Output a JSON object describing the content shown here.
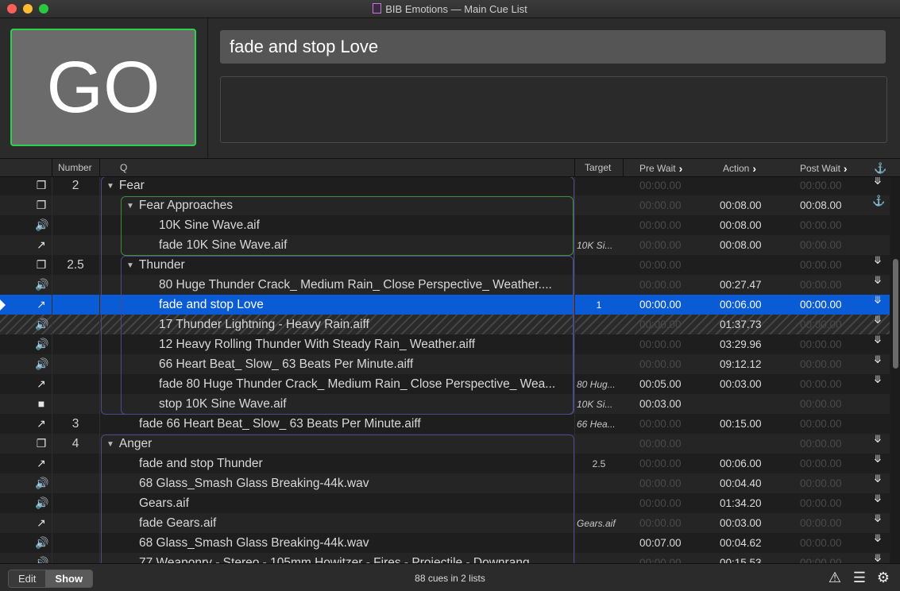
{
  "window": {
    "title": "BIB Emotions — Main Cue List"
  },
  "go_button": {
    "label": "GO"
  },
  "selected_cue": {
    "name": "fade and stop Love",
    "notes": ""
  },
  "columns": {
    "number": "Number",
    "q": "Q",
    "target": "Target",
    "pre_wait": "Pre Wait",
    "action": "Action",
    "post_wait": "Post Wait"
  },
  "cues": [
    {
      "icon": "group",
      "number": "2",
      "name": "Fear",
      "group": true,
      "target": "",
      "pre": "00:00.00",
      "pre_dim": true,
      "action": "",
      "post": "00:00.00",
      "post_dim": true,
      "cont": "auto-follow"
    },
    {
      "icon": "group",
      "number": "",
      "name": "Fear Approaches",
      "group": true,
      "target": "",
      "pre": "00:00.00",
      "pre_dim": true,
      "action": "00:08.00",
      "post": "00:08.00",
      "post_dim": false,
      "cont": "auto-continue"
    },
    {
      "icon": "audio",
      "number": "",
      "name": "10K Sine Wave.aif",
      "target": "",
      "pre": "00:00.00",
      "pre_dim": true,
      "action": "00:08.00",
      "post": "00:00.00",
      "post_dim": true,
      "cont": ""
    },
    {
      "icon": "fade",
      "number": "",
      "name": "fade 10K Sine Wave.aif",
      "target": "10K Si...",
      "pre": "00:00.00",
      "pre_dim": true,
      "action": "00:08.00",
      "post": "00:00.00",
      "post_dim": true,
      "cont": ""
    },
    {
      "icon": "group",
      "number": "2.5",
      "name": "Thunder",
      "group": true,
      "target": "",
      "pre": "00:00.00",
      "pre_dim": true,
      "action": "",
      "post": "00:00.00",
      "post_dim": true,
      "cont": "auto-follow"
    },
    {
      "icon": "audio",
      "number": "",
      "name": "80 Huge Thunder Crack_ Medium Rain_ Close Perspective_ Weather....",
      "target": "",
      "pre": "00:00.00",
      "pre_dim": true,
      "action": "00:27.47",
      "post": "00:00.00",
      "post_dim": true,
      "cont": "auto-follow"
    },
    {
      "icon": "fade",
      "number": "",
      "name": "fade and stop Love",
      "target": "1",
      "target_plain": true,
      "pre": "00:00.00",
      "pre_dim": false,
      "action": "00:06.00",
      "post": "00:00.00",
      "post_dim": false,
      "cont": "auto-follow",
      "selected": true,
      "playhead": true
    },
    {
      "icon": "audio",
      "number": "",
      "name": "17 Thunder Lightning - Heavy Rain.aiff",
      "target": "",
      "pre": "00:00.00",
      "pre_dim": true,
      "action": "01:37.73",
      "post": "00:00.00",
      "post_dim": true,
      "cont": "auto-follow",
      "broken": true
    },
    {
      "icon": "audio",
      "number": "",
      "name": "12 Heavy Rolling Thunder With Steady Rain_ Weather.aiff",
      "target": "",
      "pre": "00:00.00",
      "pre_dim": true,
      "action": "03:29.96",
      "post": "00:00.00",
      "post_dim": true,
      "cont": "auto-follow"
    },
    {
      "icon": "audio",
      "number": "",
      "name": "66 Heart Beat_ Slow_ 63 Beats Per Minute.aiff",
      "target": "",
      "pre": "00:00.00",
      "pre_dim": true,
      "action": "09:12.12",
      "post": "00:00.00",
      "post_dim": true,
      "cont": "auto-follow"
    },
    {
      "icon": "fade",
      "number": "",
      "name": "fade 80 Huge Thunder Crack_ Medium Rain_ Close Perspective_ Wea...",
      "target": "80 Hug...",
      "pre": "00:05.00",
      "pre_dim": false,
      "action": "00:03.00",
      "post": "00:00.00",
      "post_dim": true,
      "cont": "auto-follow"
    },
    {
      "icon": "stop",
      "number": "",
      "name": "stop 10K Sine Wave.aif",
      "target": "10K Si...",
      "pre": "00:03.00",
      "pre_dim": false,
      "action": "",
      "post": "00:00.00",
      "post_dim": true,
      "cont": ""
    },
    {
      "icon": "fade",
      "number": "3",
      "name": "fade 66 Heart Beat_ Slow_ 63 Beats Per Minute.aiff",
      "target": "66 Hea...",
      "pre": "00:00.00",
      "pre_dim": true,
      "action": "00:15.00",
      "post": "00:00.00",
      "post_dim": true,
      "cont": ""
    },
    {
      "icon": "group",
      "number": "4",
      "name": "Anger",
      "group": true,
      "target": "",
      "pre": "00:00.00",
      "pre_dim": true,
      "action": "",
      "post": "00:00.00",
      "post_dim": true,
      "cont": "auto-follow"
    },
    {
      "icon": "fade",
      "number": "",
      "name": "fade and stop Thunder",
      "target": "2.5",
      "target_plain": true,
      "pre": "00:00.00",
      "pre_dim": true,
      "action": "00:06.00",
      "post": "00:00.00",
      "post_dim": true,
      "cont": "auto-follow"
    },
    {
      "icon": "audio",
      "number": "",
      "name": "68 Glass_Smash Glass Breaking-44k.wav",
      "target": "",
      "pre": "00:00.00",
      "pre_dim": true,
      "action": "00:04.40",
      "post": "00:00.00",
      "post_dim": true,
      "cont": "auto-follow"
    },
    {
      "icon": "audio",
      "number": "",
      "name": "Gears.aif",
      "target": "",
      "pre": "00:00.00",
      "pre_dim": true,
      "action": "01:34.20",
      "post": "00:00.00",
      "post_dim": true,
      "cont": "auto-follow"
    },
    {
      "icon": "fade",
      "number": "",
      "name": "fade Gears.aif",
      "target": "Gears.aif",
      "pre": "00:00.00",
      "pre_dim": true,
      "action": "00:03.00",
      "post": "00:00.00",
      "post_dim": true,
      "cont": "auto-follow"
    },
    {
      "icon": "audio",
      "number": "",
      "name": "68 Glass_Smash Glass Breaking-44k.wav",
      "target": "",
      "pre": "00:07.00",
      "pre_dim": false,
      "action": "00:04.62",
      "post": "00:00.00",
      "post_dim": true,
      "cont": "auto-follow"
    },
    {
      "icon": "audio",
      "number": "",
      "name": "77 Weaponry - Stereo - 105mm Howitzer - Fires - Projectile - Downrang...",
      "target": "",
      "pre": "00:00.00",
      "pre_dim": true,
      "action": "00:15.53",
      "post": "00:00.00",
      "post_dim": true,
      "cont": "auto-follow"
    }
  ],
  "footer": {
    "edit_label": "Edit",
    "show_label": "Show",
    "status": "88 cues in 2 lists"
  },
  "colors": {
    "go_border": "#2ed14f",
    "selection": "#0a5bd6",
    "group_outer": "#4a4a8c",
    "group_fear_approaches": "#3f8a3f",
    "group_thunder": "#4a4a8c"
  }
}
